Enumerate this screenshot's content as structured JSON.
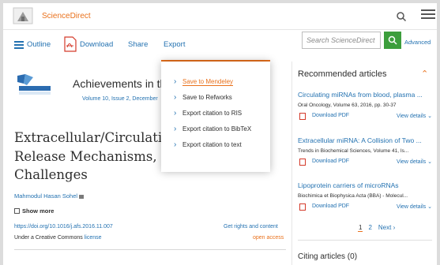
{
  "header": {
    "brand": "ScienceDirect"
  },
  "toolbar": {
    "outline_label": "Outline",
    "download_label": "Download",
    "share_label": "Share",
    "export_label": "Export",
    "search_placeholder": "Search ScienceDirect",
    "advanced_label": "Advanced"
  },
  "journal": {
    "title": "Achievements in th",
    "volume_link": "Volume 10, Issue 2, December"
  },
  "article": {
    "title_lines": [
      "Extracellular/Circulating",
      "Release Mechanisms, Fu",
      "Challenges"
    ],
    "author": "Mahmodul Hasan Sohel",
    "show_more": "Show more",
    "doi": "https://doi.org/10.1016/j.afs.2016.11.007",
    "rights": "Get rights and content",
    "license_prefix": "Under a Creative Commons ",
    "license_link": "license",
    "open_access": "open access"
  },
  "export_menu": {
    "items": [
      {
        "label": "Save to Mendeley",
        "active": true
      },
      {
        "label": "Save to Refworks"
      },
      {
        "label": "Export citation to RIS"
      },
      {
        "label": "Export citation to BibTeX"
      },
      {
        "label": "Export citation to text"
      }
    ]
  },
  "recommended": {
    "title": "Recommended articles",
    "items": [
      {
        "title": "Circulating miRNAs from blood, plasma ...",
        "source": "Oral Oncology, Volume 63, 2016, pp. 30-37",
        "pdf_label": "Download PDF",
        "view_label": "View details"
      },
      {
        "title": "Extracellular miRNA: A Collision of Two ...",
        "source": "Trends in Biochemical Sciences, Volume 41, Is...",
        "pdf_label": "Download PDF",
        "view_label": "View details"
      },
      {
        "title": "Lipoprotein carriers of microRNAs",
        "source": "Biochimica et Biophysica Acta (BBA) - Molecul...",
        "pdf_label": "Download PDF",
        "view_label": "View details"
      }
    ],
    "pager": {
      "current": "1",
      "next_page": "2",
      "next_label": "Next"
    }
  },
  "citing": {
    "label": "Citing articles (0)"
  },
  "colors": {
    "accent": "#e9711c",
    "link": "#2472b1",
    "search_button": "#3c9e3c"
  }
}
